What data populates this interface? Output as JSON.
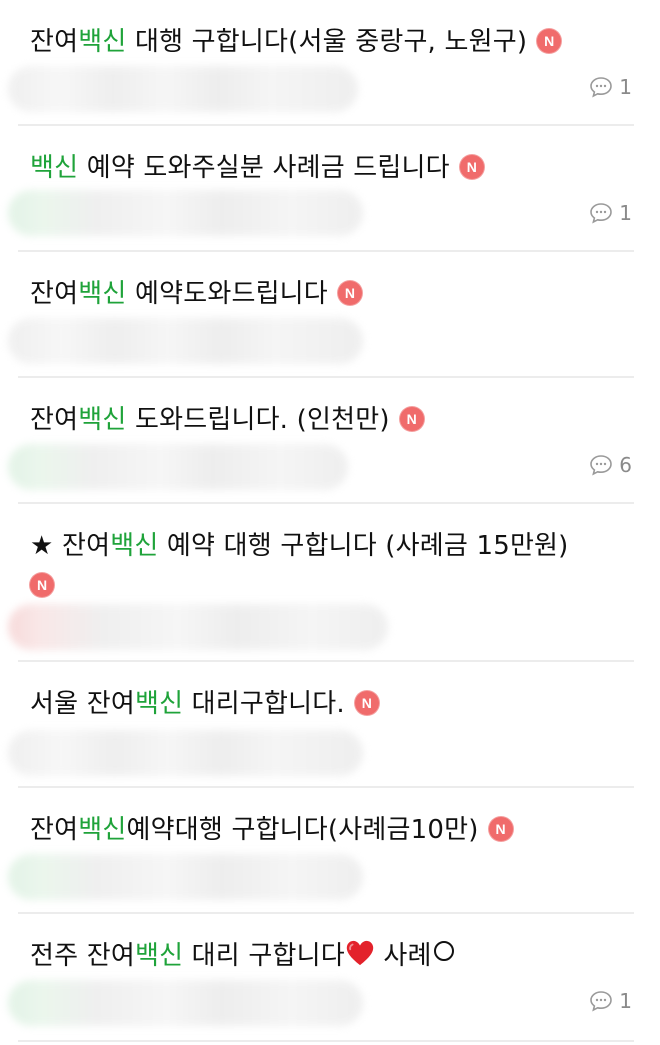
{
  "posts": [
    {
      "prefix": "잔여",
      "keyword": "백신",
      "suffix": " 대행 구합니다(서울 중랑구, 노원구)",
      "badge": "N",
      "comments": "1"
    },
    {
      "prefix": "",
      "keyword": "백신",
      "suffix": " 예약 도와주실분 사례금 드립니다",
      "badge": "N",
      "comments": "1"
    },
    {
      "prefix": "잔여",
      "keyword": "백신",
      "suffix": " 예약도와드립니다",
      "badge": "N",
      "comments": ""
    },
    {
      "prefix": "잔여",
      "keyword": "백신",
      "suffix": " 도와드립니다. (인천만)",
      "badge": "N",
      "comments": "6"
    },
    {
      "prefix": "★ 잔여",
      "keyword": "백신",
      "suffix": " 예약 대행 구합니다 (사례금 15만원)",
      "badge": "N",
      "comments": ""
    },
    {
      "prefix": "서울 잔여",
      "keyword": "백신",
      "suffix": " 대리구합니다.",
      "badge": "N",
      "comments": ""
    },
    {
      "prefix": "잔여",
      "keyword": "백신",
      "suffix": "예약대행 구합니다(사례금10만)",
      "badge": "N",
      "comments": ""
    },
    {
      "prefix": "전주 잔여",
      "keyword": "백신",
      "suffix": " 대리 구합니다",
      "after_heart": " 사례",
      "badge": "",
      "comments": "1"
    }
  ],
  "colors": {
    "keyword": "#1fa33a",
    "badge": "#f06b6b",
    "comment": "#8a8a8a"
  },
  "icons": {
    "badge": "new-badge",
    "comment": "comment-bubble-icon",
    "heart": "heart-icon"
  }
}
